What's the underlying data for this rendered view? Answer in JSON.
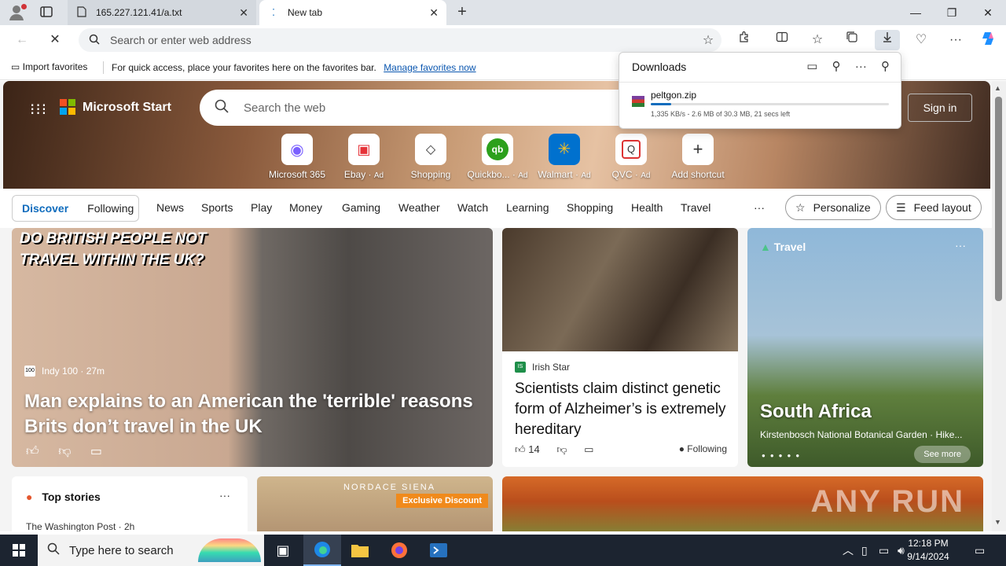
{
  "tabs": [
    {
      "title": "165.227.121.41/a.txt"
    },
    {
      "title": "New tab"
    }
  ],
  "address_bar": {
    "placeholder": "Search or enter web address"
  },
  "favorites_bar": {
    "import_label": "Import favorites",
    "message": "For quick access, place your favorites here on the favorites bar.",
    "link": "Manage favorites now"
  },
  "downloads": {
    "title": "Downloads",
    "file_name": "peltgon.zip",
    "status": "1,335 KB/s - 2.6 MB of 30.3 MB, 21 secs left",
    "progress_fraction": 0.086
  },
  "header": {
    "brand": "Microsoft Start",
    "search_placeholder": "Search the web",
    "sign_in": "Sign in"
  },
  "shortcuts": [
    {
      "label": "Microsoft 365",
      "ad": ""
    },
    {
      "label": "Ebay",
      "ad": "Ad"
    },
    {
      "label": "Shopping",
      "ad": ""
    },
    {
      "label": "Quickbo...",
      "ad": "Ad"
    },
    {
      "label": "Walmart",
      "ad": "Ad"
    },
    {
      "label": "QVC",
      "ad": "Ad"
    },
    {
      "label": "Add shortcut",
      "ad": ""
    }
  ],
  "nav": {
    "discover": "Discover",
    "following": "Following",
    "items": [
      "News",
      "Sports",
      "Play",
      "Money",
      "Gaming",
      "Weather",
      "Watch",
      "Learning",
      "Shopping",
      "Health",
      "Travel"
    ],
    "more": "···",
    "personalize": "Personalize",
    "feed_layout": "Feed layout"
  },
  "cards": {
    "main": {
      "overlay_text": "DO BRITISH PEOPLE NOT TRAVEL WITHIN THE UK?",
      "source": "Indy 100 · 27m",
      "source_badge": "100",
      "headline": "Man explains to an American the 'terrible' reasons Brits don’t travel in the UK"
    },
    "second": {
      "source": "Irish Star",
      "headline": "Scientists claim distinct genetic form of Alzheimer’s is extremely hereditary",
      "likes": "14",
      "following": "Following"
    },
    "travel": {
      "category": "Travel",
      "title": "South Africa",
      "subtitle": "Kirstenbosch National Botanical Garden · Hike...",
      "see_more": "See more"
    },
    "top_stories": {
      "title": "Top stories",
      "source": "The Washington Post · 2h"
    },
    "ad": {
      "brand": "NORDACE SIENA",
      "badge": "Exclusive Discount"
    },
    "watermark": "ANY RUN"
  },
  "taskbar": {
    "search_placeholder": "Type here to search",
    "time": "12:18 PM",
    "date": "9/14/2024"
  }
}
